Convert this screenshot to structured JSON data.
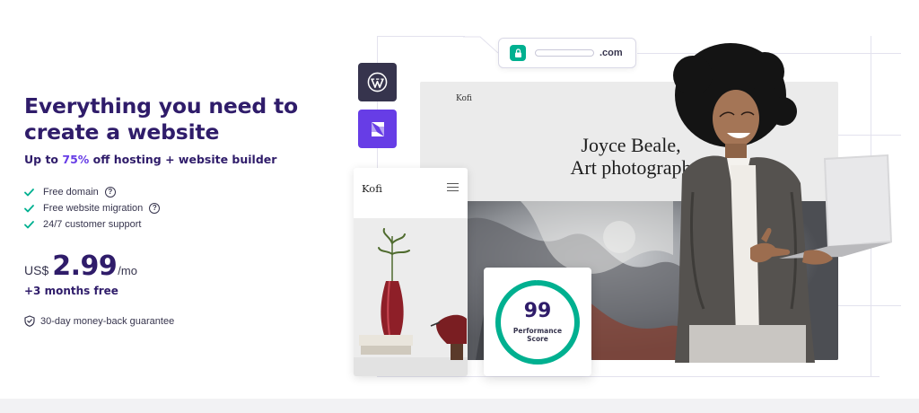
{
  "hero": {
    "headline_line1": "Everything you need to",
    "headline_line2": "create a website",
    "subline_prefix": "Up to ",
    "subline_accent": "75%",
    "subline_suffix": " off hosting + website builder",
    "features": [
      {
        "label": "Free domain",
        "help": "?"
      },
      {
        "label": "Free website migration",
        "help": "?"
      },
      {
        "label": "24/7 customer support"
      }
    ],
    "price": {
      "currency": "US$",
      "amount": "2.99",
      "period": "/mo"
    },
    "bonus": "+3 months free",
    "guarantee": "30-day money-back guarantee"
  },
  "illustration": {
    "url_suffix": ".com",
    "site_brand": "Kofi",
    "site_title_line1": "Joyce Beale,",
    "site_title_line2": "Art photograph",
    "mobile_brand": "Kofi",
    "score_value": "99",
    "score_label_line1": "Performance",
    "score_label_line2": "Score",
    "icons": [
      "lock-icon",
      "wordpress-icon",
      "website-builder-icon",
      "hamburger-menu-icon"
    ]
  },
  "colors": {
    "brand_dark": "#2f1c6a",
    "accent_purple": "#673de6",
    "success_green": "#00b090",
    "text": "#36344d"
  }
}
